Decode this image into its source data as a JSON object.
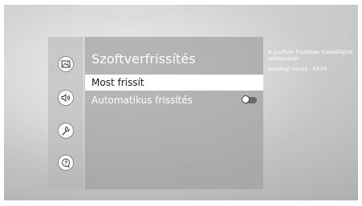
{
  "menu": {
    "icons": [
      {
        "name": "picture-icon"
      },
      {
        "name": "sound-icon"
      },
      {
        "name": "wrench-icon"
      },
      {
        "name": "support-icon"
      }
    ]
  },
  "panel": {
    "title": "Szoftverfrissítés",
    "items": [
      {
        "label": "Most frissít",
        "selected": true
      },
      {
        "label": "Automatikus frissítés",
        "toggle": "off"
      }
    ]
  },
  "info": {
    "description": "A szoftver frissítése frissítőfájlok letöltésével.",
    "version": "Jelenlegi verzió : XXXX"
  }
}
